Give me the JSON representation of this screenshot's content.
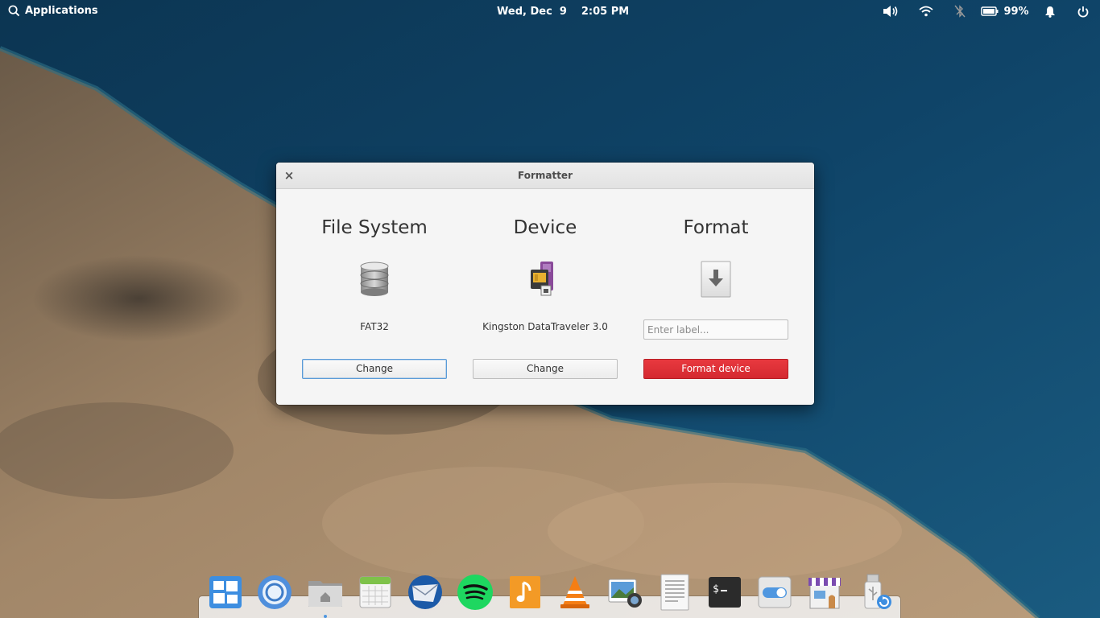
{
  "panel": {
    "applications_label": "Applications",
    "date": "Wed, Dec  9",
    "time": "2:05 PM",
    "battery_percent": "99%",
    "battery_level": 0.99
  },
  "window": {
    "title": "Formatter",
    "close_glyph": "×",
    "columns": {
      "filesystem": {
        "heading": "File System",
        "value": "FAT32",
        "button": "Change",
        "icon": "database-icon"
      },
      "device": {
        "heading": "Device",
        "value": "Kingston DataTraveler 3.0",
        "button": "Change",
        "icon": "drive-removable-icon"
      },
      "format": {
        "heading": "Format",
        "placeholder": "Enter label...",
        "value": "",
        "button": "Format device",
        "icon": "format-down-arrow-icon"
      }
    }
  },
  "colors": {
    "accent_blue": "#5a9bd8",
    "destructive_red": "#d42930",
    "window_bg": "#f5f5f5"
  },
  "dock": {
    "items": [
      "multitasking-view-icon",
      "web-browser-icon",
      "files-icon",
      "calendar-icon",
      "mail-icon",
      "spotify-icon",
      "music-icon",
      "vlc-icon",
      "photos-icon",
      "text-editor-icon",
      "terminal-icon",
      "system-settings-icon",
      "appcenter-icon",
      "formatter-usb-icon"
    ]
  }
}
